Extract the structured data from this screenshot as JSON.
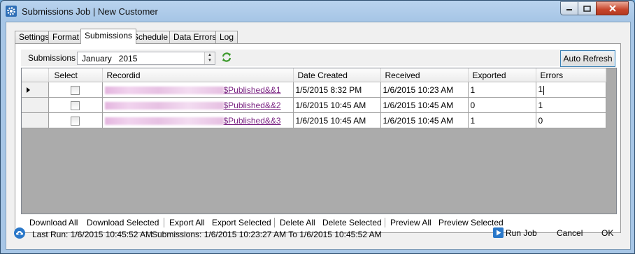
{
  "window": {
    "title": "Submissions Job | New Customer"
  },
  "tabs": [
    {
      "label": "Settings"
    },
    {
      "label": "Format"
    },
    {
      "label": "Submissions"
    },
    {
      "label": "Schedule"
    },
    {
      "label": "Data Errors"
    },
    {
      "label": "Log"
    }
  ],
  "toolbar": {
    "label": "Submissions",
    "month_value": "January   2015",
    "auto_refresh_label": "Auto Refresh"
  },
  "grid": {
    "columns": [
      "Select",
      "Recordid",
      "Date Created",
      "Received",
      "Exported",
      "Errors"
    ],
    "rows": [
      {
        "recordid_suffix": "$Published&&1",
        "date_created": "1/5/2015 8:32 PM",
        "received": "1/6/2015 10:23 AM",
        "exported": "1",
        "errors": "1"
      },
      {
        "recordid_suffix": "$Published&&2",
        "date_created": "1/6/2015 10:45 AM",
        "received": "1/6/2015 10:45 AM",
        "exported": "0",
        "errors": "1"
      },
      {
        "recordid_suffix": "$Published&&3",
        "date_created": "1/6/2015 10:45 AM",
        "received": "1/6/2015 10:45 AM",
        "exported": "1",
        "errors": "0"
      }
    ]
  },
  "actions": {
    "download_all": "Download All",
    "download_selected": "Download Selected",
    "export_all": "Export All",
    "export_selected": "Export Selected",
    "delete_all": "Delete All",
    "delete_selected": "Delete Selected",
    "preview_all": "Preview All",
    "preview_selected": "Preview Selected"
  },
  "status": {
    "last_run": "Last Run: 1/6/2015 10:45:52 AM",
    "submissions_range": "Submissions: 1/6/2015 10:23:27 AM To 1/6/2015 10:45:52 AM"
  },
  "buttons": {
    "run_job": "Run Job",
    "cancel": "Cancel",
    "ok": "OK"
  },
  "icons": {
    "app": "gear-icon",
    "refresh": "refresh-icon",
    "status": "cloud-upload-icon",
    "run": "play-icon"
  },
  "colors": {
    "link": "#7a2282",
    "title_bar": "#a7c6e6",
    "close_button": "#c7452b"
  }
}
